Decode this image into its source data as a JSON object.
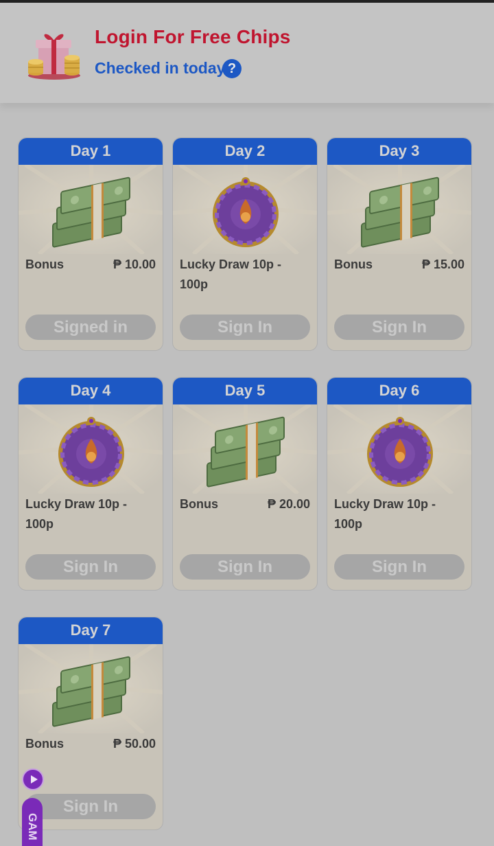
{
  "header": {
    "title": "Login For Free Chips",
    "subtitle": "Checked in today",
    "help_glyph": "?",
    "gift_icon": "gift-with-coins-icon",
    "colors": {
      "title": "#c0152f",
      "accent": "#1d58c4"
    }
  },
  "days": [
    {
      "title": "Day 1",
      "reward_type": "cash",
      "label": "Bonus",
      "amount": "₱ 10.00",
      "button": "Signed in"
    },
    {
      "title": "Day 2",
      "reward_type": "wheel",
      "label": "Lucky Draw 10p - 100p",
      "amount": "",
      "button": "Sign In"
    },
    {
      "title": "Day 3",
      "reward_type": "cash",
      "label": "Bonus",
      "amount": "₱ 15.00",
      "button": "Sign In"
    },
    {
      "title": "Day 4",
      "reward_type": "wheel",
      "label": "Lucky Draw 10p - 100p",
      "amount": "",
      "button": "Sign In"
    },
    {
      "title": "Day 5",
      "reward_type": "cash",
      "label": "Bonus",
      "amount": "₱ 20.00",
      "button": "Sign In"
    },
    {
      "title": "Day 6",
      "reward_type": "wheel",
      "label": "Lucky Draw 10p - 100p",
      "amount": "",
      "button": "Sign In"
    },
    {
      "title": "Day 7",
      "reward_type": "cash",
      "label": "Bonus",
      "amount": "₱ 50.00",
      "button": "Sign In"
    }
  ],
  "floating": {
    "play_icon": "play-icon",
    "game_tab_label": "GAM"
  }
}
